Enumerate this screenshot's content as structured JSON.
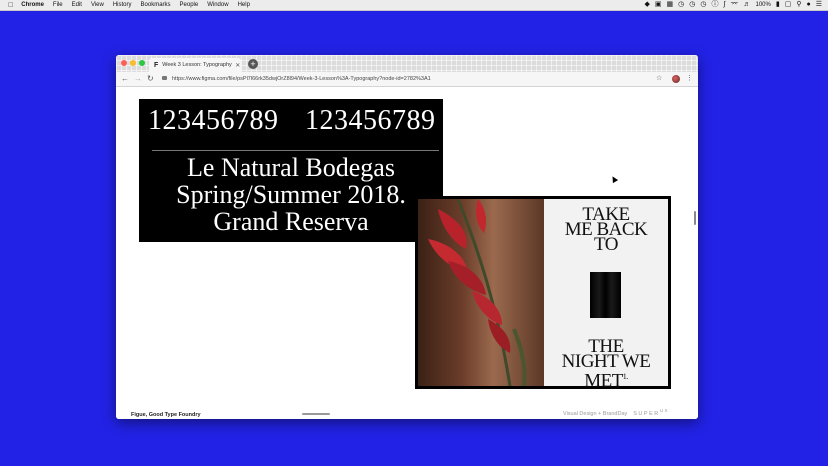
{
  "menubar": {
    "app": "Chrome",
    "items": [
      "File",
      "Edit",
      "View",
      "History",
      "Bookmarks",
      "People",
      "Window",
      "Help"
    ],
    "battery": "100%"
  },
  "browser": {
    "tab_title": "Week 3 Lesson: Typography -",
    "url": "https://www.figma.com/file/psPl7l66rk35dwjOrZ8l94/Week-3-Lesson%3A-Typography?node-id=2782%3A1"
  },
  "content": {
    "numerals_lining": "123456789",
    "numerals_oldstyle": "123456789",
    "headline_line1": "Le Natural Bodegas",
    "headline_line2": "Spring/Summer 2018.",
    "headline_line3": "Grand Reserva",
    "poster_top_1": "TAKE",
    "poster_top_2": "ME BACK",
    "poster_top_3": "TO",
    "poster_bottom_1": "THE",
    "poster_bottom_2": "NIGHT WE",
    "poster_bottom_3": "MET",
    "poster_bottom_sup": "1.",
    "footer_left": "Figue, Good Type Foundry",
    "footer_right": "Visual Design + BrandDay",
    "footer_brand": "SUPER",
    "footer_brand_sup": "UX"
  }
}
